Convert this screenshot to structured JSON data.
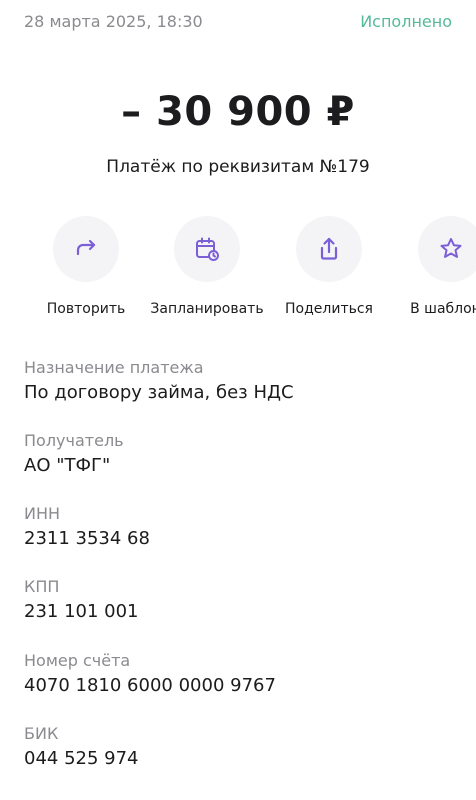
{
  "header": {
    "datetime": "28 марта 2025, 18:30",
    "status": "Исполнено"
  },
  "payment": {
    "amount": "– 30 900 ₽",
    "title": "Платёж по реквизитам №179"
  },
  "actions": [
    {
      "label": "Повторить",
      "icon": "repeat-icon"
    },
    {
      "label": "Запланировать",
      "icon": "calendar-schedule-icon"
    },
    {
      "label": "Поделиться",
      "icon": "share-icon"
    },
    {
      "label": "В шаблоны",
      "icon": "star-icon"
    }
  ],
  "details": [
    {
      "label": "Назначение платежа",
      "value": "По договору займа, без НДС"
    },
    {
      "label": "Получатель",
      "value": "АО \"ТФГ\""
    },
    {
      "label": "ИНН",
      "value": "2311 3534 68"
    },
    {
      "label": "КПП",
      "value": "231 101 001"
    },
    {
      "label": "Номер счёта",
      "value": "4070 1810 6000 0000 9767"
    },
    {
      "label": "БИК",
      "value": "044 525 974"
    }
  ],
  "colors": {
    "accent": "#7b5fd6",
    "status": "#55b99a",
    "secondary_text": "#8a8a8f",
    "primary_text": "#1c1c1e",
    "circle_bg": "#f4f4f6"
  }
}
